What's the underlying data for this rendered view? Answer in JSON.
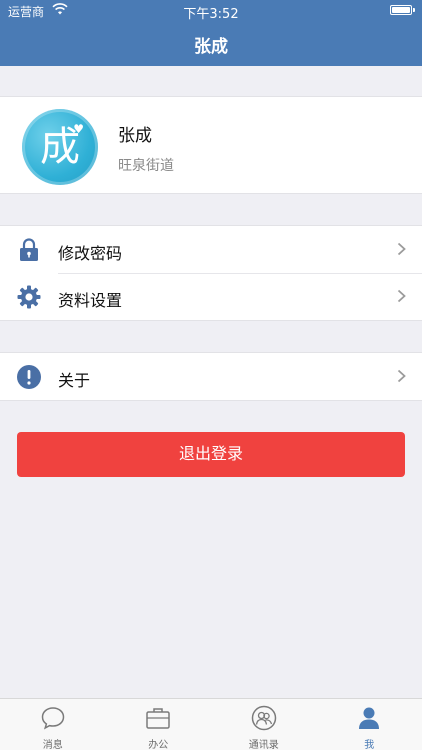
{
  "status_bar": {
    "carrier": "运营商",
    "time": "下午3:52"
  },
  "nav": {
    "title": "张成"
  },
  "profile": {
    "avatar_char": "成",
    "name": "张成",
    "district": "旺泉街道"
  },
  "menu_groups": [
    [
      {
        "label": "修改密码",
        "icon": "lock-icon"
      },
      {
        "label": "资料设置",
        "icon": "gear-icon"
      }
    ],
    [
      {
        "label": "关于",
        "icon": "info-icon"
      }
    ]
  ],
  "logout": {
    "label": "退出登录"
  },
  "tabs": [
    {
      "label": "消息",
      "icon": "message-icon",
      "active": false
    },
    {
      "label": "办公",
      "icon": "briefcase-icon",
      "active": false
    },
    {
      "label": "通讯录",
      "icon": "contacts-icon",
      "active": false
    },
    {
      "label": "我",
      "icon": "person-icon",
      "active": true
    }
  ],
  "colors": {
    "nav_bg": "#4a7bb5",
    "accent": "#4a7bb5",
    "logout_bg": "#f0423f",
    "background": "#efeff4"
  }
}
